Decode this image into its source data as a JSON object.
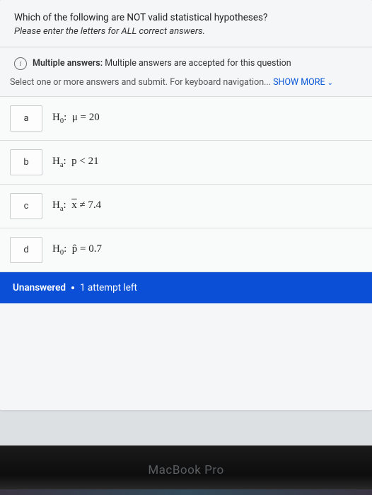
{
  "question": {
    "title": "Which of the following are NOT valid statistical hypotheses?",
    "instruction": "Please enter the letters for ALL correct answers."
  },
  "multiAnswer": {
    "label": "Multiple answers:",
    "text": "Multiple answers are accepted for this question"
  },
  "navHint": {
    "prefix": "Select one or more answers and submit. For keyboard navigation... ",
    "showMore": "SHOW MORE"
  },
  "options": [
    {
      "letter": "a",
      "hyp": "H₀:  μ = 20"
    },
    {
      "letter": "b",
      "hyp": "Hₐ:  p < 21"
    },
    {
      "letter": "c",
      "hyp": "Hₐ:  x̄ ≠ 7.4"
    },
    {
      "letter": "d",
      "hyp": "H₀:  p̂ = 0.7"
    }
  ],
  "status": {
    "state": "Unanswered",
    "attempts": "1 attempt left"
  },
  "device": "MacBook Pro",
  "icons": {
    "info": "i",
    "chevron": "⌄"
  }
}
